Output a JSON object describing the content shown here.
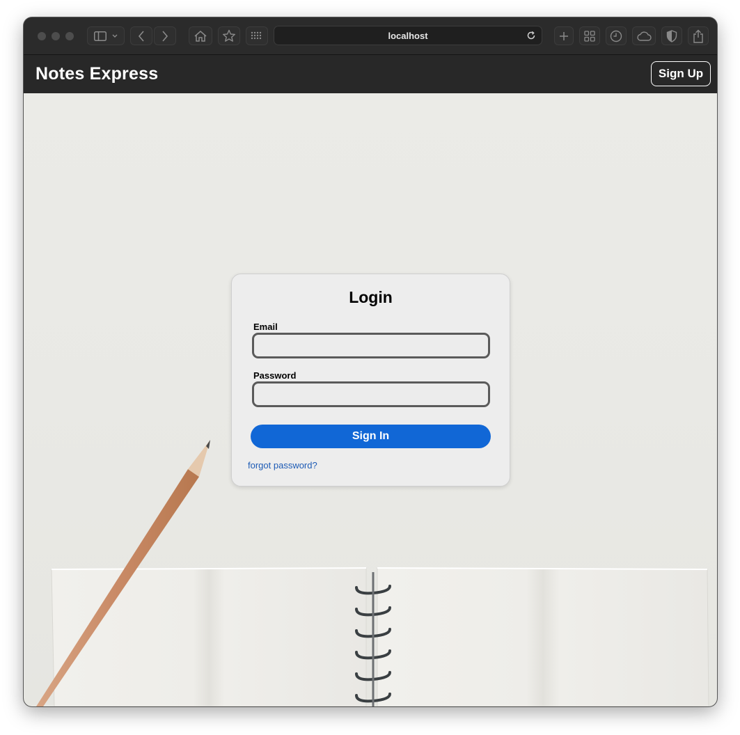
{
  "browser": {
    "url": "localhost",
    "icons": [
      "sidebar-icon",
      "chevron-down-icon",
      "back-icon",
      "forward-icon",
      "home-icon",
      "star-icon",
      "grid-apps-icon",
      "reload-icon",
      "new-tab-icon",
      "tab-overview-icon",
      "history-icon",
      "cloud-icon",
      "shield-icon",
      "share-icon"
    ]
  },
  "navbar": {
    "brand": "Notes Express",
    "signup_label": "Sign Up"
  },
  "login": {
    "title": "Login",
    "email_label": "Email",
    "email_value": "",
    "password_label": "Password",
    "password_value": "",
    "signin_label": "Sign In",
    "forgot_label": "forgot password?"
  },
  "colors": {
    "navbar_bg": "#282828",
    "primary": "#1167d6",
    "link": "#1d5bb5",
    "card_bg": "#ededed"
  }
}
